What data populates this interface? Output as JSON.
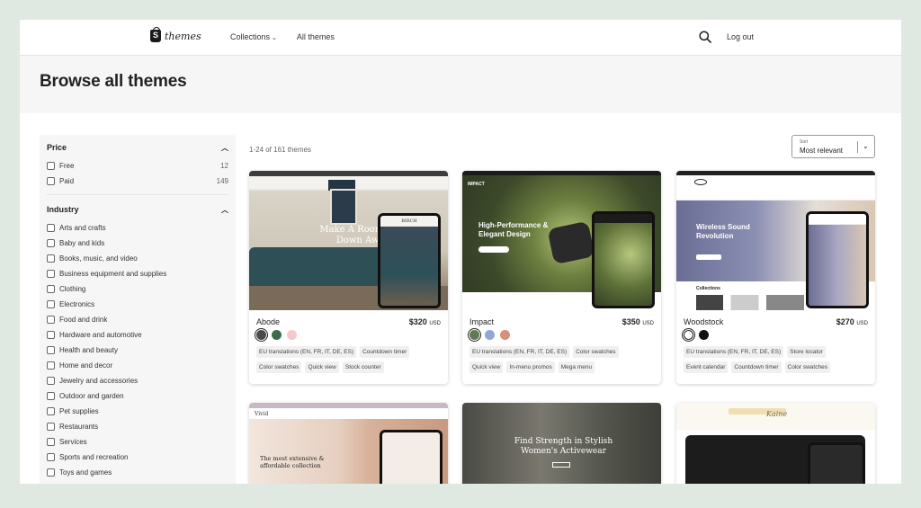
{
  "header": {
    "logo_text": "themes",
    "nav": [
      {
        "label": "Collections",
        "has_dropdown": true
      },
      {
        "label": "All themes",
        "has_dropdown": false
      }
    ],
    "logout_label": "Log out"
  },
  "page_title": "Browse all themes",
  "sidebar": {
    "price": {
      "title": "Price",
      "options": [
        {
          "label": "Free",
          "count": "12"
        },
        {
          "label": "Paid",
          "count": "149"
        }
      ]
    },
    "industry": {
      "title": "Industry",
      "options": [
        "Arts and crafts",
        "Baby and kids",
        "Books, music, and video",
        "Business equipment and supplies",
        "Clothing",
        "Electronics",
        "Food and drink",
        "Hardware and automotive",
        "Health and beauty",
        "Home and decor",
        "Jewelry and accessories",
        "Outdoor and garden",
        "Pet supplies",
        "Restaurants",
        "Services",
        "Sports and recreation",
        "Toys and games"
      ]
    }
  },
  "results": {
    "count_text": "1-24 of 161 themes",
    "sort_label": "Sort",
    "sort_value": "Most relevant"
  },
  "themes": [
    {
      "name": "Abode",
      "price": "$320",
      "currency": "USD",
      "swatches": [
        "#4a4a4a",
        "#3f6b4c",
        "#f6c7cf"
      ],
      "tags": [
        "EU translations (EN, FR, IT, DE, ES)",
        "Countdown timer",
        "Color swatches",
        "Quick view",
        "Stock counter"
      ],
      "preview": {
        "headline": "Make A Room To Sit Down Awhile",
        "brand": "BIRCH"
      }
    },
    {
      "name": "Impact",
      "price": "$350",
      "currency": "USD",
      "swatches": [
        "#5f7a55",
        "#8fa8d6",
        "#d9907a"
      ],
      "tags": [
        "EU translations (EN, FR, IT, DE, ES)",
        "Color swatches",
        "Quick view",
        "In-menu promos",
        "Mega menu"
      ],
      "preview": {
        "headline": "High-Performance & Elegant Design",
        "brand": "IMPACT"
      }
    },
    {
      "name": "Woodstock",
      "price": "$270",
      "currency": "USD",
      "swatches": [
        "#ffffff",
        "#111111"
      ],
      "tags": [
        "EU translations (EN, FR, IT, DE, ES)",
        "Store locator",
        "Event calendar",
        "Countdown timer",
        "Color swatches"
      ],
      "preview": {
        "headline": "Wireless Sound Revolution",
        "section": "Collections"
      }
    }
  ],
  "second_row_previews": [
    {
      "headline": "The most extensive & affordable collection",
      "brand": "Vivid"
    },
    {
      "headline": "Find Strength in Stylish Women's Activewear"
    },
    {
      "brand": "Kaine"
    }
  ]
}
